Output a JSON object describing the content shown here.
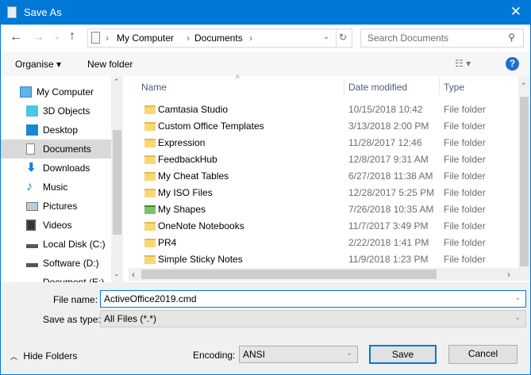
{
  "title": "Save As",
  "address": {
    "crumbs": [
      "My Computer",
      "Documents"
    ]
  },
  "search": {
    "placeholder": "Search Documents"
  },
  "toolbar": {
    "organise": "Organise ▾",
    "new_folder": "New folder"
  },
  "nav": [
    "My Computer",
    "3D Objects",
    "Desktop",
    "Documents",
    "Downloads",
    "Music",
    "Pictures",
    "Videos",
    "Local Disk (C:)",
    "Software (D:)",
    "Document (E:)"
  ],
  "columns": {
    "name": "Name",
    "date": "Date modified",
    "type": "Type"
  },
  "files": [
    {
      "name": "Camtasia Studio",
      "date": "10/15/2018 10:42",
      "type": "File folder"
    },
    {
      "name": "Custom Office Templates",
      "date": "3/13/2018 2:00 PM",
      "type": "File folder"
    },
    {
      "name": "Expression",
      "date": "11/28/2017 12:46",
      "type": "File folder"
    },
    {
      "name": "FeedbackHub",
      "date": "12/8/2017 9:31 AM",
      "type": "File folder"
    },
    {
      "name": "My Cheat Tables",
      "date": "6/27/2018 11:38 AM",
      "type": "File folder"
    },
    {
      "name": "My ISO Files",
      "date": "12/28/2017 5:25 PM",
      "type": "File folder"
    },
    {
      "name": "My Shapes",
      "date": "7/26/2018 10:35 AM",
      "type": "File folder"
    },
    {
      "name": "OneNote Notebooks",
      "date": "11/7/2017 3:49 PM",
      "type": "File folder"
    },
    {
      "name": "PR4",
      "date": "2/22/2018 1:41 PM",
      "type": "File folder"
    },
    {
      "name": "Simple Sticky Notes",
      "date": "11/9/2018 1:23 PM",
      "type": "File folder"
    }
  ],
  "form": {
    "filename_label": "File name:",
    "filename": "ActiveOffice2019.cmd",
    "type_label": "Save as type:",
    "type": "All Files  (*.*)",
    "encoding_label": "Encoding:",
    "encoding": "ANSI",
    "save": "Save",
    "cancel": "Cancel",
    "hide_folders": "Hide Folders"
  }
}
